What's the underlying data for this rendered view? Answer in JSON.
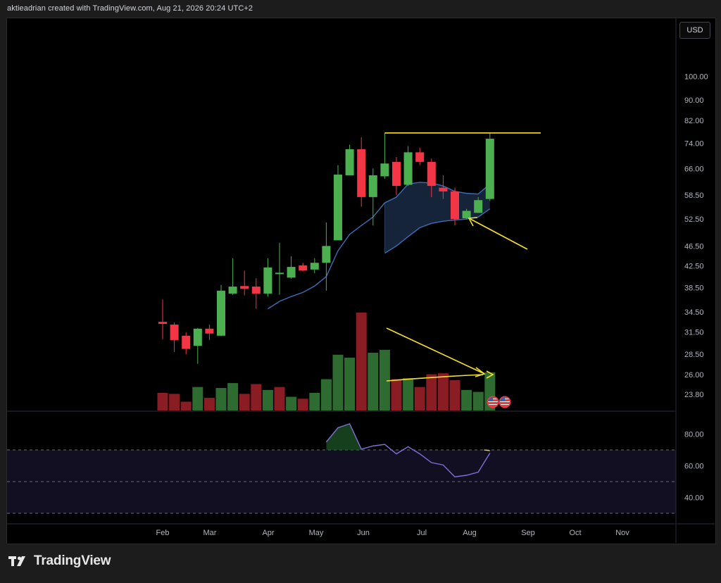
{
  "header": {
    "text": "aktieadrian created with TradingView.com, Aug 21, 2026 20:24 UTC+2"
  },
  "currency_button": {
    "label": "USD"
  },
  "footer": {
    "brand": "TradingView"
  },
  "colors": {
    "up": "#4caf50",
    "down": "#f23645",
    "vol_up": "#2e6b30",
    "vol_down": "#8a1c24",
    "ma": "#3d6eb5",
    "cloud": "#1a2a44",
    "annotation": "#f5e12c",
    "rsi": "#7e6fd6",
    "rsi_band": "#130f23"
  },
  "chart_data": [
    {
      "type": "candlestick",
      "y_axis_ticks": [
        "100.00",
        "90.00",
        "82.00",
        "74.00",
        "66.00",
        "58.50",
        "52.50",
        "46.50",
        "42.50",
        "38.50",
        "34.50",
        "31.50",
        "28.50",
        "26.00",
        "23.80"
      ],
      "x_axis_ticks": [
        "Feb",
        "Mar",
        "Apr",
        "May",
        "Jun",
        "Jul",
        "Aug",
        "Sep",
        "Oct",
        "Nov"
      ],
      "y_scale": "log",
      "ylim": [
        23.3,
        108
      ],
      "candles": [
        {
          "o": 33.0,
          "h": 36.5,
          "l": 30.5,
          "c": 32.7
        },
        {
          "o": 32.6,
          "h": 32.9,
          "l": 28.8,
          "c": 30.4
        },
        {
          "o": 31.0,
          "h": 31.5,
          "l": 28.5,
          "c": 29.2
        },
        {
          "o": 29.6,
          "h": 32.1,
          "l": 27.3,
          "c": 32.0
        },
        {
          "o": 32.0,
          "h": 32.6,
          "l": 30.4,
          "c": 31.3
        },
        {
          "o": 31.0,
          "h": 39.0,
          "l": 30.9,
          "c": 38.0
        },
        {
          "o": 37.5,
          "h": 44.0,
          "l": 37.3,
          "c": 38.7
        },
        {
          "o": 38.8,
          "h": 41.6,
          "l": 37.2,
          "c": 38.3
        },
        {
          "o": 38.7,
          "h": 40.2,
          "l": 35.0,
          "c": 37.5
        },
        {
          "o": 37.5,
          "h": 44.0,
          "l": 37.0,
          "c": 42.2
        },
        {
          "o": 41.1,
          "h": 47.2,
          "l": 37.3,
          "c": 41.2
        },
        {
          "o": 40.3,
          "h": 44.4,
          "l": 40.1,
          "c": 42.3
        },
        {
          "o": 42.6,
          "h": 43.1,
          "l": 41.5,
          "c": 41.6
        },
        {
          "o": 41.8,
          "h": 44.0,
          "l": 41.1,
          "c": 43.1
        },
        {
          "o": 43.1,
          "h": 51.7,
          "l": 38.0,
          "c": 46.5
        },
        {
          "o": 47.7,
          "h": 67.0,
          "l": 47.7,
          "c": 64.2
        },
        {
          "o": 64.0,
          "h": 73.5,
          "l": 64.0,
          "c": 72.0
        },
        {
          "o": 72.0,
          "h": 76.0,
          "l": 55.5,
          "c": 58.0
        },
        {
          "o": 58.0,
          "h": 66.0,
          "l": 51.0,
          "c": 64.0
        },
        {
          "o": 63.7,
          "h": 77.5,
          "l": 63.0,
          "c": 67.5
        },
        {
          "o": 68.0,
          "h": 69.5,
          "l": 58.5,
          "c": 61.0
        },
        {
          "o": 61.3,
          "h": 73.0,
          "l": 61.0,
          "c": 71.0
        },
        {
          "o": 71.0,
          "h": 72.5,
          "l": 67.0,
          "c": 68.0
        },
        {
          "o": 68.0,
          "h": 69.0,
          "l": 58.0,
          "c": 61.0
        },
        {
          "o": 60.5,
          "h": 64.0,
          "l": 57.5,
          "c": 59.5
        },
        {
          "o": 59.5,
          "h": 60.5,
          "l": 51.0,
          "c": 52.5
        },
        {
          "o": 52.7,
          "h": 55.0,
          "l": 52.5,
          "c": 54.5
        },
        {
          "o": 54.0,
          "h": 58.0,
          "l": 54.0,
          "c": 57.2
        },
        {
          "o": 57.5,
          "h": 77.5,
          "l": 57.0,
          "c": 75.5
        }
      ],
      "moving_average": [
        {
          "i": 9,
          "v": 35.0
        },
        {
          "i": 10,
          "v": 36.2
        },
        {
          "i": 11,
          "v": 37.0
        },
        {
          "i": 12,
          "v": 37.7
        },
        {
          "i": 13,
          "v": 38.8
        },
        {
          "i": 14,
          "v": 40.5
        },
        {
          "i": 15,
          "v": 45.5
        },
        {
          "i": 16,
          "v": 49.0
        },
        {
          "i": 17,
          "v": 51.0
        },
        {
          "i": 18,
          "v": 53.0
        },
        {
          "i": 19,
          "v": 56.5
        },
        {
          "i": 20,
          "v": 58.0
        },
        {
          "i": 21,
          "v": 61.5
        },
        {
          "i": 22,
          "v": 62.0
        },
        {
          "i": 23,
          "v": 61.8
        },
        {
          "i": 24,
          "v": 61.0
        },
        {
          "i": 25,
          "v": 59.5
        },
        {
          "i": 26,
          "v": 59.0
        },
        {
          "i": 27,
          "v": 58.8
        },
        {
          "i": 28,
          "v": 61.5
        }
      ],
      "cloud_lower": [
        {
          "i": 19,
          "v": 45.0
        },
        {
          "i": 20,
          "v": 46.5
        },
        {
          "i": 21,
          "v": 48.5
        },
        {
          "i": 22,
          "v": 50.5
        },
        {
          "i": 23,
          "v": 51.5
        },
        {
          "i": 24,
          "v": 52.0
        },
        {
          "i": 25,
          "v": 52.3
        },
        {
          "i": 26,
          "v": 52.5
        },
        {
          "i": 27,
          "v": 53.0
        },
        {
          "i": 28,
          "v": 55.0
        }
      ],
      "resistance_level": 77.5,
      "volume": {
        "relative": [
          0.18,
          0.17,
          0.09,
          0.24,
          0.13,
          0.23,
          0.28,
          0.17,
          0.27,
          0.21,
          0.24,
          0.14,
          0.12,
          0.18,
          0.32,
          0.57,
          0.54,
          1.0,
          0.59,
          0.62,
          0.32,
          0.33,
          0.24,
          0.37,
          0.38,
          0.31,
          0.21,
          0.19,
          0.39
        ],
        "direction": [
          "down",
          "down",
          "down",
          "up",
          "down",
          "up",
          "up",
          "down",
          "down",
          "up",
          "down",
          "up",
          "down",
          "up",
          "up",
          "up",
          "up",
          "down",
          "up",
          "up",
          "down",
          "up",
          "down",
          "down",
          "down",
          "down",
          "up",
          "up",
          "up"
        ]
      }
    },
    {
      "type": "line",
      "y_axis_ticks": [
        "80.00",
        "60.00",
        "40.00"
      ],
      "ylim": [
        30,
        92
      ],
      "bands": [
        70,
        50,
        30
      ],
      "values": [
        {
          "i": 14,
          "v": 75.0
        },
        {
          "i": 15,
          "v": 84.0
        },
        {
          "i": 16,
          "v": 86.5
        },
        {
          "i": 17,
          "v": 70.5
        },
        {
          "i": 18,
          "v": 72.5
        },
        {
          "i": 19,
          "v": 73.5
        },
        {
          "i": 20,
          "v": 67.5
        },
        {
          "i": 21,
          "v": 72.0
        },
        {
          "i": 22,
          "v": 67.5
        },
        {
          "i": 23,
          "v": 62.0
        },
        {
          "i": 24,
          "v": 60.5
        },
        {
          "i": 25,
          "v": 53.0
        },
        {
          "i": 26,
          "v": 54.0
        },
        {
          "i": 27,
          "v": 56.0
        },
        {
          "i": 28,
          "v": 68.0
        }
      ]
    }
  ]
}
